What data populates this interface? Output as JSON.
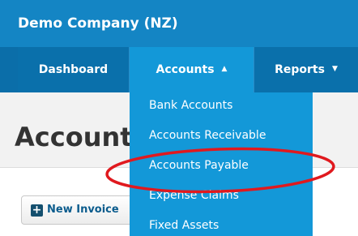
{
  "header": {
    "company_name": "Demo Company (NZ)"
  },
  "nav": {
    "tabs": [
      {
        "label": "Dashboard",
        "has_caret": false
      },
      {
        "label": "Accounts",
        "has_caret": true,
        "caret": "▲",
        "active": true
      },
      {
        "label": "Reports",
        "has_caret": true,
        "caret": "▼"
      }
    ]
  },
  "page": {
    "title": "Accounts",
    "new_invoice_label": "New Invoice",
    "plus_icon": "+"
  },
  "accounts_menu": {
    "items": [
      {
        "label": "Bank Accounts"
      },
      {
        "label": "Accounts Receivable"
      },
      {
        "label": "Accounts Payable",
        "highlighted": true
      },
      {
        "label": "Expense Claims"
      },
      {
        "label": "Fixed Assets"
      }
    ]
  },
  "colors": {
    "top_bar": "#1485c4",
    "nav_bar": "#0b6ea9",
    "active_tab": "#1398d8",
    "dropdown": "#1398d8",
    "highlight": "#e0191e"
  }
}
